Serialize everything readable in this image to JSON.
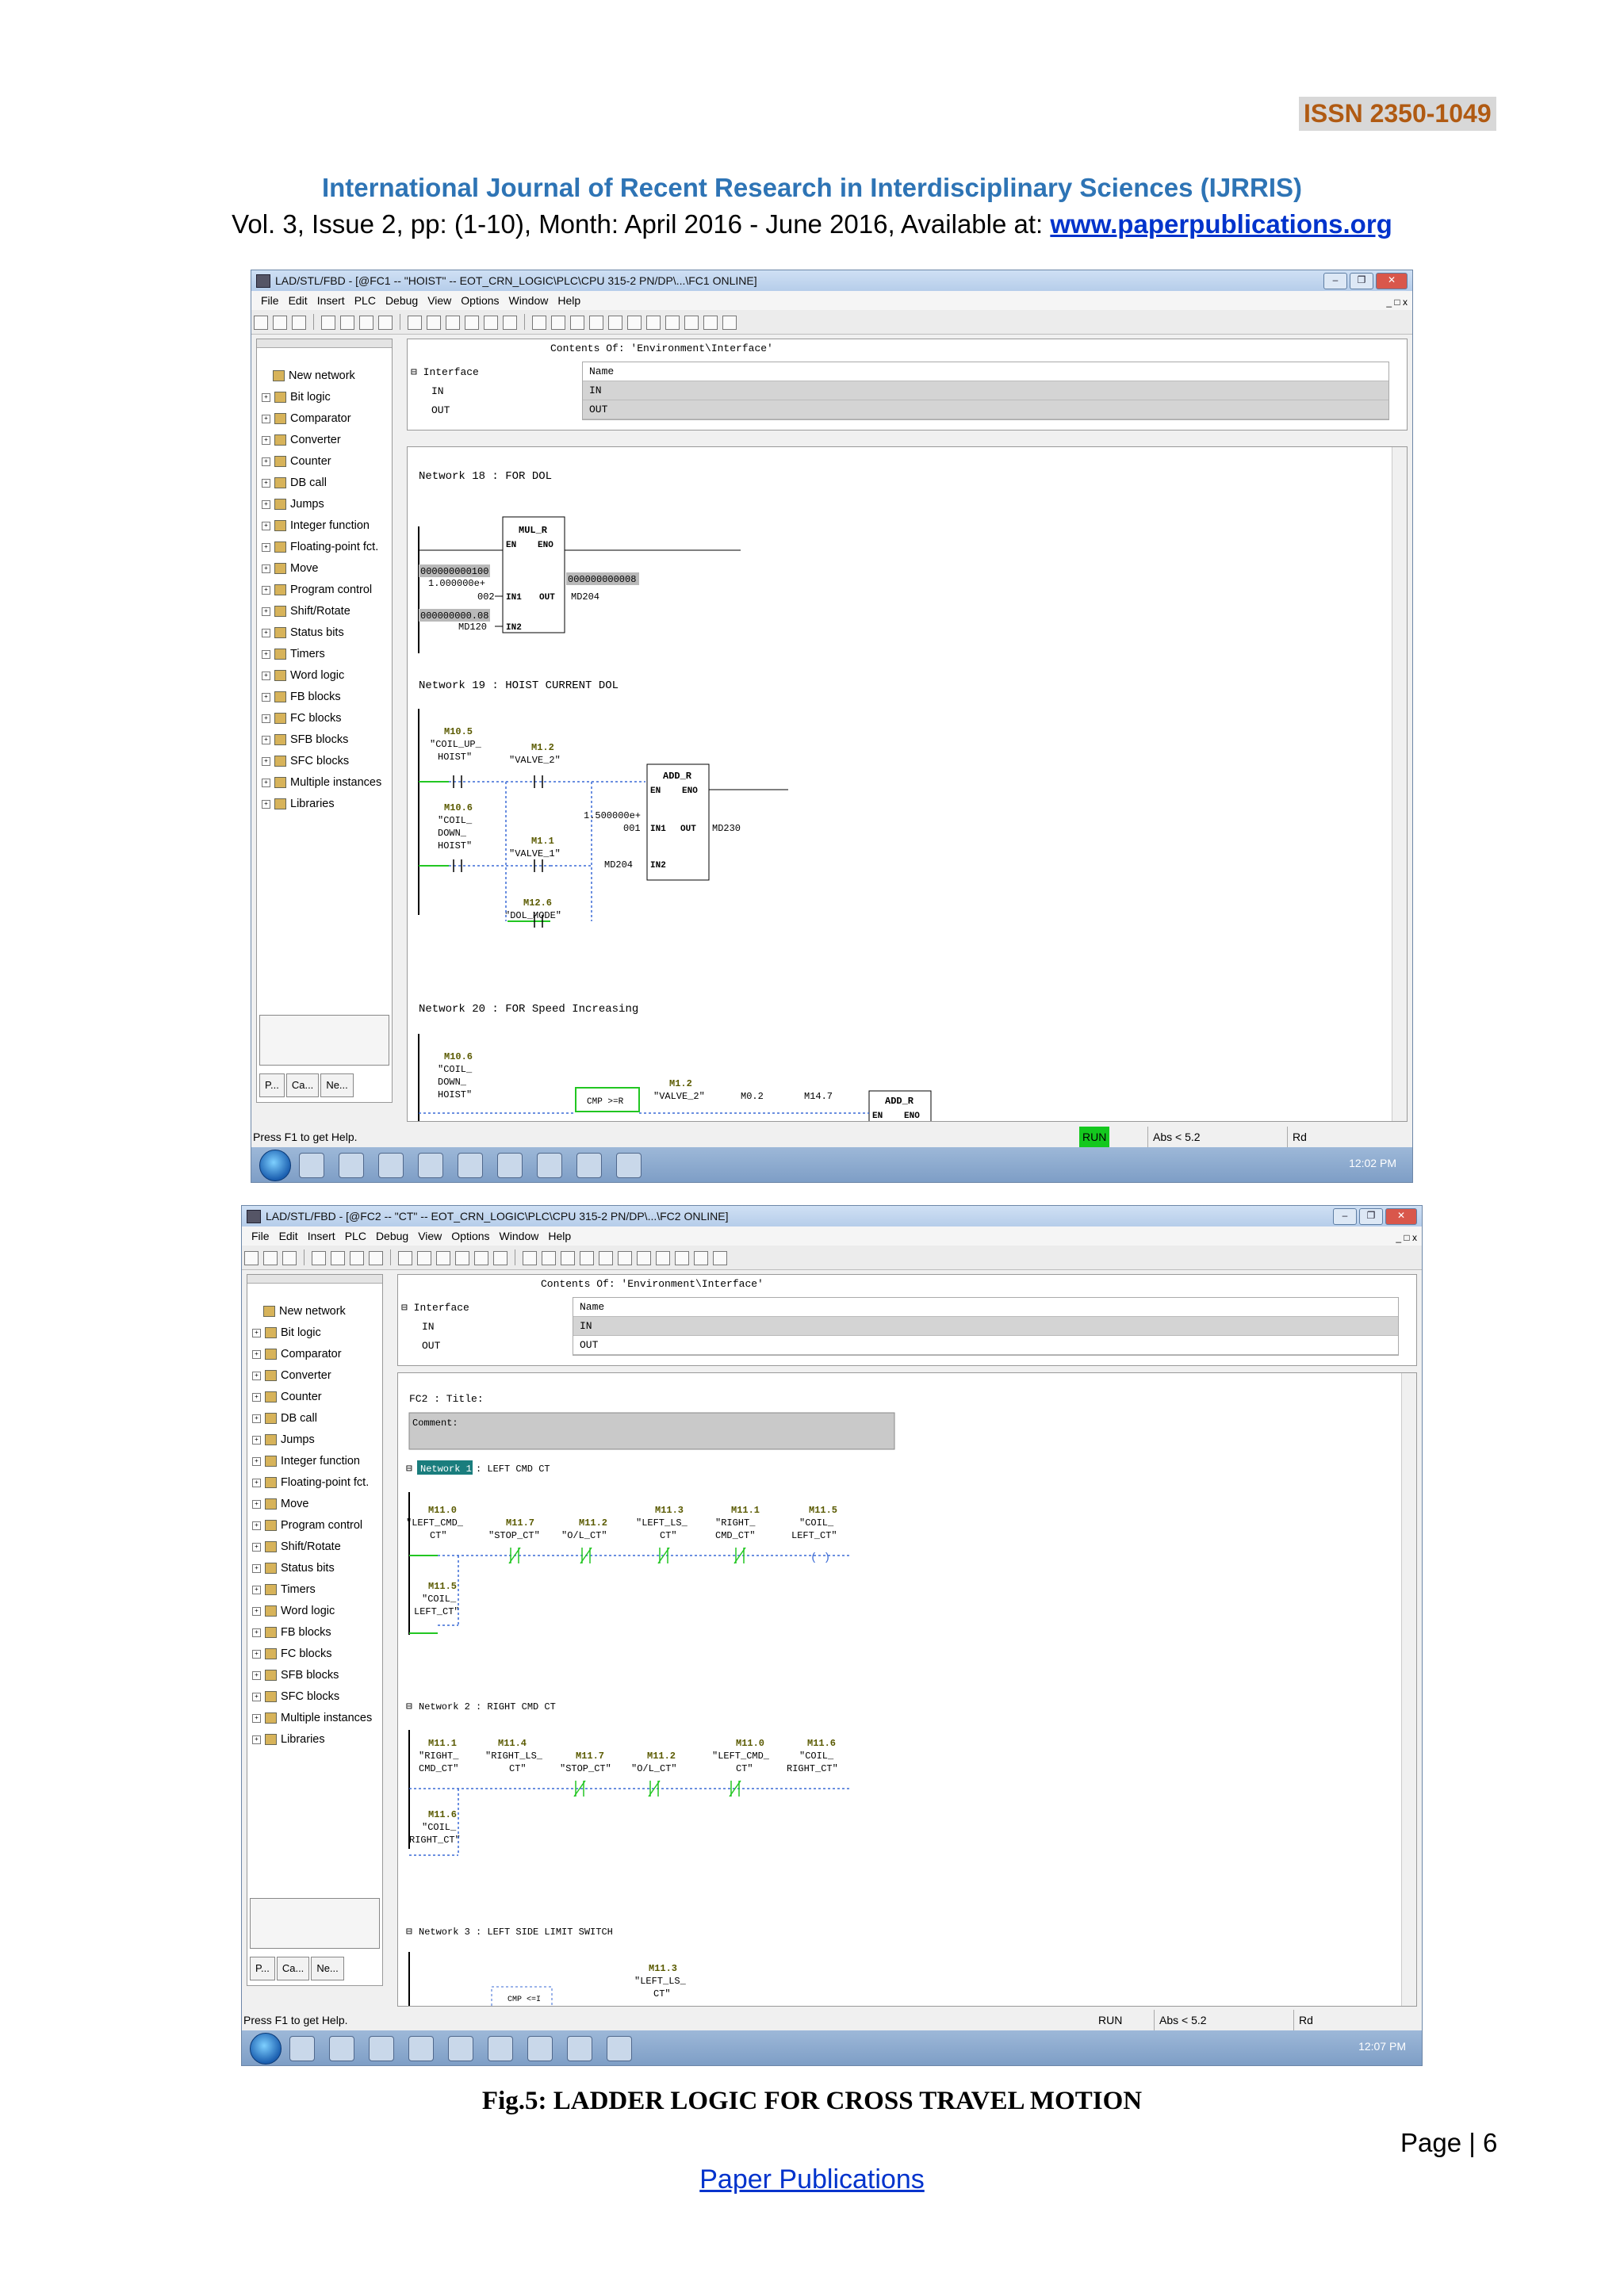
{
  "header": {
    "issn": "ISSN  2350-1049",
    "journal_title": "International Journal of Recent Research in Interdisciplinary Sciences (IJRRIS)",
    "issue_line_prefix": "Vol. 3, Issue 2, pp: (1-10), Month: April 2016 - June 2016, Available at: ",
    "issue_line_link": "www.paperpublications.org"
  },
  "screens": [
    {
      "title": "LAD/STL/FBD  - [@FC1 -- \"HOIST\" -- EOT_CRN_LOGIC\\PLC\\CPU 315-2 PN/DP\\...\\FC1  ONLINE]",
      "menu": [
        "File",
        "Edit",
        "Insert",
        "PLC",
        "Debug",
        "View",
        "Options",
        "Window",
        "Help"
      ],
      "interface": {
        "contents_header": "Contents Of: 'Environment\\Interface'",
        "tree_root": "Interface",
        "tree_items": [
          "IN",
          "OUT"
        ],
        "grid_header": "Name",
        "grid_rows": [
          "IN",
          "OUT"
        ]
      },
      "networks": [
        {
          "title": "Network 18 : FOR DOL",
          "box": {
            "name": "MUL_R",
            "en": "EN",
            "eno": "ENO",
            "in1": "IN1",
            "in2": "IN2",
            "out": "OUT"
          },
          "in1_value_a": "000000000100",
          "in1_value_b": "1.000000e+",
          "in1_value_c": "002",
          "in2_value_a": "000000000.08",
          "in2_value_b": "MD120",
          "out_value_a": "000000000008",
          "out_value_b": "MD204"
        },
        {
          "title": "Network 19 : HOIST CURRENT DOL",
          "contacts": [
            {
              "addr": "M10.5",
              "sym": [
                "\"COIL_UP_",
                "HOIST\""
              ]
            },
            {
              "addr": "M1.2",
              "sym": [
                "\"VALVE_2\""
              ]
            },
            {
              "addr": "M10.6",
              "sym": [
                "\"COIL_",
                "DOWN_",
                "HOIST\""
              ]
            },
            {
              "addr": "M1.1",
              "sym": [
                "\"VALVE_1\""
              ]
            },
            {
              "addr": "M12.6",
              "sym": [
                "\"DOL_MODE\""
              ]
            }
          ],
          "box": {
            "name": "ADD_R",
            "en": "EN",
            "eno": "ENO",
            "in1": "IN1",
            "in2": "IN2",
            "out": "OUT"
          },
          "in1_value_a": "1.500000e+",
          "in1_value_b": "001",
          "in2_value": "MD204",
          "out_value": "MD230"
        },
        {
          "title": "Network 20 : FOR Speed Increasing",
          "contacts": [
            {
              "addr": "M10.6",
              "sym": [
                "\"COIL_",
                "DOWN_",
                "HOIST\""
              ]
            },
            {
              "addr": "M1.2",
              "sym": [
                "\"VALVE_2\""
              ]
            },
            {
              "addr": "M0.2",
              "sym": []
            },
            {
              "addr": "M14.7",
              "sym": []
            }
          ],
          "cmp": "CMP >=R",
          "box": {
            "name": "ADD_R",
            "en": "EN",
            "eno": "ENO"
          }
        }
      ],
      "catalog_tabs": [
        "P...",
        "Ca...",
        "Ne..."
      ],
      "status": {
        "help": "Press F1 to get Help.",
        "run": "RUN",
        "abs": "Abs < 5.2",
        "rd": "Rd"
      },
      "clock": "12:02 PM"
    },
    {
      "title": "LAD/STL/FBD  - [@FC2 -- \"CT\" -- EOT_CRN_LOGIC\\PLC\\CPU 315-2 PN/DP\\...\\FC2  ONLINE]",
      "menu": [
        "File",
        "Edit",
        "Insert",
        "PLC",
        "Debug",
        "View",
        "Options",
        "Window",
        "Help"
      ],
      "interface": {
        "contents_header": "Contents Of: 'Environment\\Interface'",
        "tree_root": "Interface",
        "tree_items": [
          "IN",
          "OUT"
        ],
        "grid_header": "Name",
        "grid_rows": [
          "IN",
          "OUT"
        ]
      },
      "fc_title": "FC2 : Title:",
      "comment": "Comment:",
      "networks": [
        {
          "title_badge": "Network 1",
          "title_rest": ": LEFT CMD CT",
          "contacts": [
            {
              "addr": "M11.0",
              "sym": [
                "\"LEFT_CMD_",
                "CT\""
              ]
            },
            {
              "addr": "M11.7",
              "sym": [
                "\"STOP_CT\""
              ]
            },
            {
              "addr": "M11.2",
              "sym": [
                "\"O/L_CT\""
              ]
            },
            {
              "addr": "M11.3",
              "sym": [
                "\"LEFT_LS_",
                "CT\""
              ]
            },
            {
              "addr": "M11.1",
              "sym": [
                "\"RIGHT_",
                "CMD_CT\""
              ]
            },
            {
              "addr": "M11.5",
              "sym": [
                "\"COIL_",
                "LEFT_CT\""
              ]
            },
            {
              "addr": "M11.5",
              "sym": [
                "\"COIL_",
                "LEFT_CT\""
              ]
            }
          ]
        },
        {
          "title": "Network 2 : RIGHT CMD CT",
          "contacts": [
            {
              "addr": "M11.1",
              "sym": [
                "\"RIGHT_",
                "CMD_CT\""
              ]
            },
            {
              "addr": "M11.4",
              "sym": [
                "\"RIGHT_LS_",
                "CT\""
              ]
            },
            {
              "addr": "M11.7",
              "sym": [
                "\"STOP_CT\""
              ]
            },
            {
              "addr": "M11.2",
              "sym": [
                "\"O/L_CT\""
              ]
            },
            {
              "addr": "M11.0",
              "sym": [
                "\"LEFT_CMD_",
                "CT\""
              ]
            },
            {
              "addr": "M11.6",
              "sym": [
                "\"COIL_",
                "RIGHT_CT\""
              ]
            },
            {
              "addr": "M11.6",
              "sym": [
                "\"COIL_",
                "RIGHT_CT\""
              ]
            }
          ]
        },
        {
          "title": "Network 3 : LEFT SIDE LIMIT SWITCH",
          "contacts": [
            {
              "addr": "M11.3",
              "sym": [
                "\"LEFT_LS_",
                "CT\""
              ]
            }
          ],
          "cmp": "CMP <=I"
        }
      ],
      "catalog_tabs": [
        "P...",
        "Ca...",
        "Ne..."
      ],
      "status": {
        "help": "Press F1 to get Help.",
        "run": "RUN",
        "abs": "Abs < 5.2",
        "rd": "Rd"
      },
      "clock": "12:07 PM"
    }
  ],
  "catalog_items": [
    "New network",
    "Bit logic",
    "Comparator",
    "Converter",
    "Counter",
    "DB call",
    "Jumps",
    "Integer function",
    "Floating-point fct.",
    "Move",
    "Program control",
    "Shift/Rotate",
    "Status bits",
    "Timers",
    "Word logic",
    "FB blocks",
    "FC blocks",
    "SFB blocks",
    "SFC blocks",
    "Multiple instances",
    "Libraries"
  ],
  "caption": "Fig.5: LADDER   LOGIC FOR CROSS TRAVEL MOTION",
  "page_number": "Page | 6",
  "footer": "Paper Publications",
  "colors": {
    "title_blue": "#2e74b5",
    "issn_text": "#b05a12",
    "ladder_green": "#22c622",
    "ladder_label": "#7a7a00",
    "run_green": "#14c81e"
  }
}
